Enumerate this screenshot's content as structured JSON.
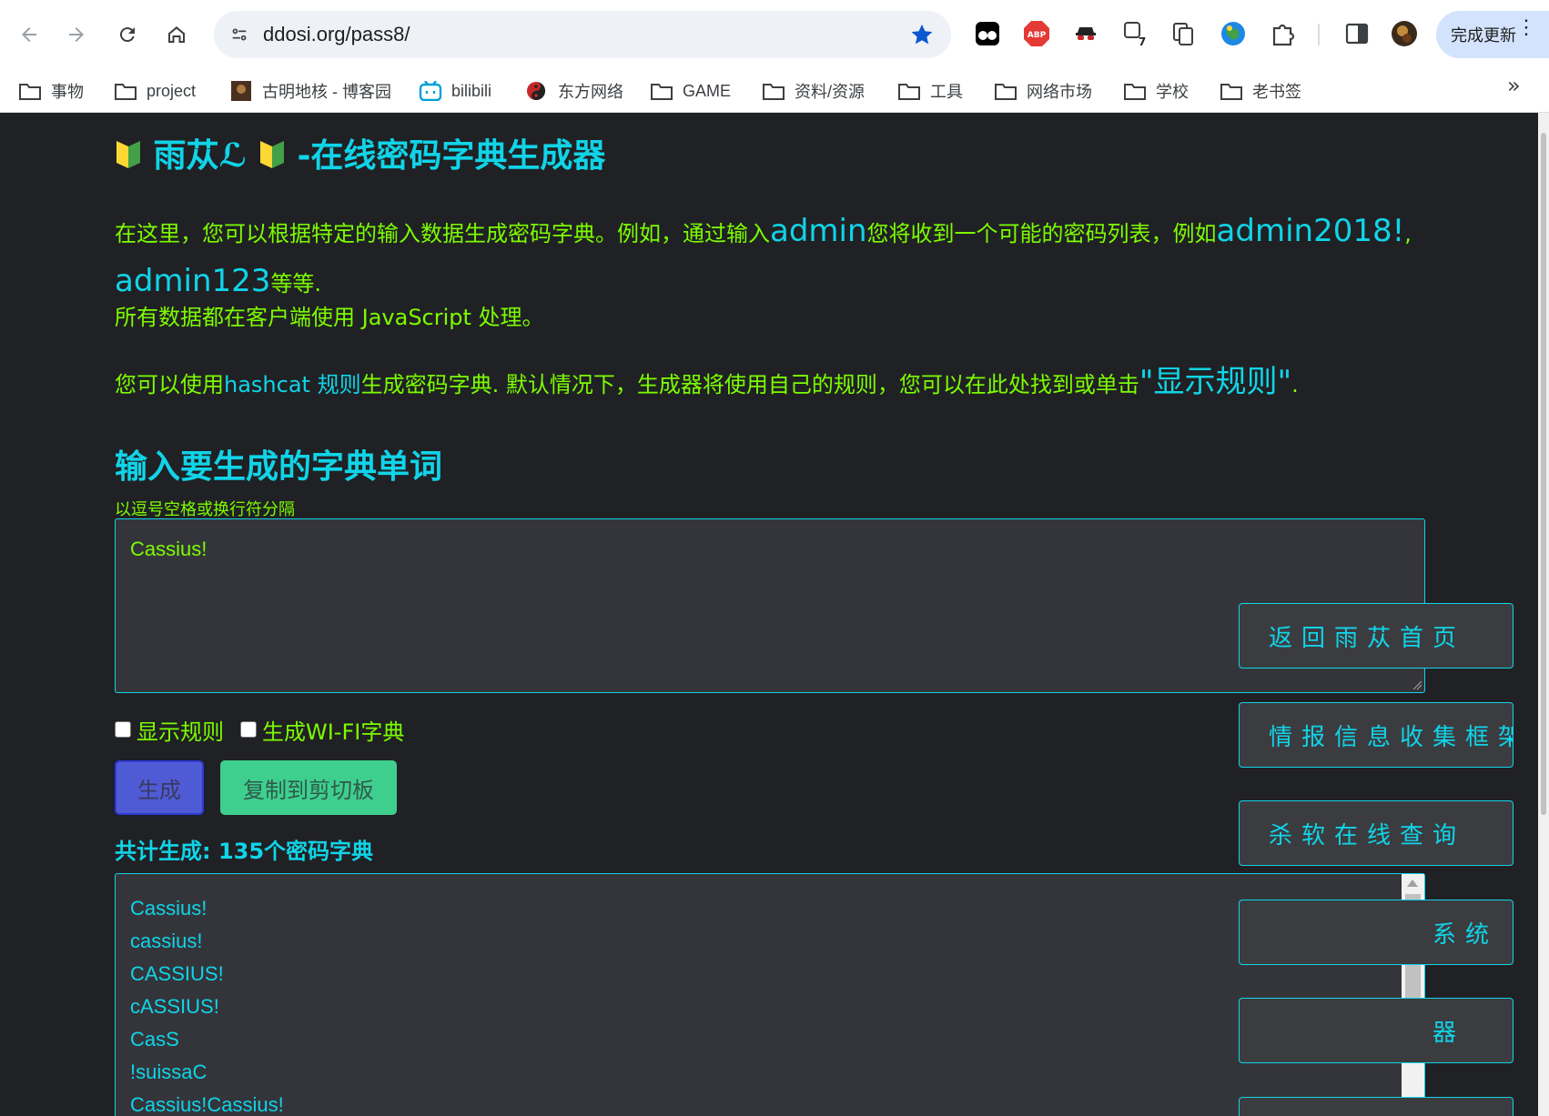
{
  "browser": {
    "url": "ddosi.org/pass8/",
    "update_label": "完成更新",
    "bookmarks": [
      {
        "label": "事物",
        "icon": "folder-icon"
      },
      {
        "label": "project",
        "icon": "folder-icon"
      },
      {
        "label": "古明地核 - 博客园",
        "icon": "avatar-icon"
      },
      {
        "label": "bilibili",
        "icon": "bilibili-icon"
      },
      {
        "label": "东方网络",
        "icon": "yinyang-icon"
      },
      {
        "label": "GAME",
        "icon": "folder-icon"
      },
      {
        "label": "资料/资源",
        "icon": "folder-icon"
      },
      {
        "label": "工具",
        "icon": "folder-icon"
      },
      {
        "label": "网络市场",
        "icon": "folder-icon"
      },
      {
        "label": "学校",
        "icon": "folder-icon"
      },
      {
        "label": "老书签",
        "icon": "folder-icon"
      }
    ]
  },
  "page": {
    "title": "雨苁ℒ",
    "title_suffix": "-在线密码字典生成器",
    "intro": {
      "p1a": "在这里，您可以根据特定的输入数据生成密码字典。例如，通过输入",
      "p1_admin": "admin",
      "p1b": "您将收到一个可能的密码列表，例如",
      "p1_ex1": "admin2018!",
      "p1_comma": ",",
      "p1_ex2": "admin123",
      "p1c": "等等.",
      "p2": "所有数据都在客户端使用 JavaScript 处理。",
      "p3a": "您可以使用",
      "p3_link": "hashcat 规则",
      "p3b": "生成密码字典. 默认情况下，生成器将使用自己的规则，您可以在此处找到或单击",
      "p3_rules": "\"显示规则\"",
      "p3c": "."
    },
    "section_title": "输入要生成的字典单词",
    "hint": "以逗号空格或换行符分隔",
    "input_value": "Cassius!",
    "checkbox_rules": "显示规则",
    "checkbox_wifi": "生成WI-FI字典",
    "generate_label": "生成",
    "copy_label": "复制到剪切板",
    "total_label": "共计生成: 135个密码字典",
    "output_lines": [
      "Cassius!",
      "cassius!",
      "CASSIUS!",
      "cASSIUS!",
      "CasS",
      "!suissaC",
      "Cassius!Cassius!"
    ]
  },
  "side_menu": [
    "返回雨苁首页",
    "情报信息收集框架",
    "杀软在线查询",
    "系统",
    "器"
  ],
  "colors": {
    "accent_cyan": "#10d4e8",
    "text_green": "#7cfc00",
    "background": "#202124"
  }
}
